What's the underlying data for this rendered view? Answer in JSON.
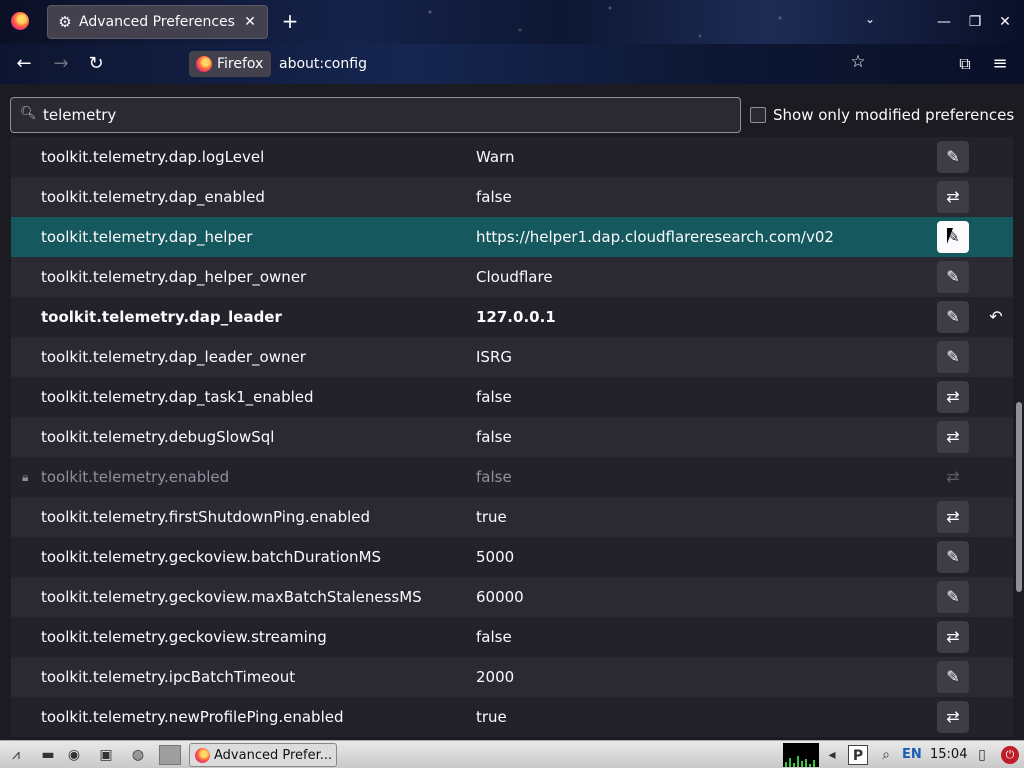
{
  "window": {
    "tab_title": "Advanced Preferences",
    "tab_icon": "gear-icon",
    "newtab_label": "+",
    "minimize_glyph": "—",
    "maximize_glyph": "❐",
    "close_glyph": "✕"
  },
  "nav": {
    "identity_label": "Firefox",
    "url": "about:config"
  },
  "search": {
    "value": "telemetry",
    "modified_only_label": "Show only modified preferences",
    "modified_only_checked": false
  },
  "preferences": [
    {
      "name": "toolkit.telemetry.dap.logLevel",
      "value": "Warn",
      "action": "edit"
    },
    {
      "name": "toolkit.telemetry.dap_enabled",
      "value": "false",
      "action": "toggle"
    },
    {
      "name": "toolkit.telemetry.dap_helper",
      "value": "https://helper1.dap.cloudflareresearch.com/v02",
      "action": "edit",
      "selected": true
    },
    {
      "name": "toolkit.telemetry.dap_helper_owner",
      "value": "Cloudflare",
      "action": "edit"
    },
    {
      "name": "toolkit.telemetry.dap_leader",
      "value": "127.0.0.1",
      "action": "edit",
      "modified": true
    },
    {
      "name": "toolkit.telemetry.dap_leader_owner",
      "value": "ISRG",
      "action": "edit"
    },
    {
      "name": "toolkit.telemetry.dap_task1_enabled",
      "value": "false",
      "action": "toggle"
    },
    {
      "name": "toolkit.telemetry.debugSlowSql",
      "value": "false",
      "action": "toggle"
    },
    {
      "name": "toolkit.telemetry.enabled",
      "value": "false",
      "action": "toggle",
      "locked": true
    },
    {
      "name": "toolkit.telemetry.firstShutdownPing.enabled",
      "value": "true",
      "action": "toggle"
    },
    {
      "name": "toolkit.telemetry.geckoview.batchDurationMS",
      "value": "5000",
      "action": "edit"
    },
    {
      "name": "toolkit.telemetry.geckoview.maxBatchStalenessMS",
      "value": "60000",
      "action": "edit"
    },
    {
      "name": "toolkit.telemetry.geckoview.streaming",
      "value": "false",
      "action": "toggle"
    },
    {
      "name": "toolkit.telemetry.ipcBatchTimeout",
      "value": "2000",
      "action": "edit"
    },
    {
      "name": "toolkit.telemetry.newProfilePing.enabled",
      "value": "true",
      "action": "toggle"
    }
  ],
  "icons": {
    "edit": "pencil-icon",
    "toggle": "toggle-arrows-icon",
    "reset": "reset-icon",
    "lock": "lock-icon"
  },
  "taskbar": {
    "task_label": "Advanced Prefer...",
    "language": "EN",
    "clock": "15:04"
  },
  "colors": {
    "selected_row": "#15585e",
    "page_background": "#1c1b22"
  }
}
